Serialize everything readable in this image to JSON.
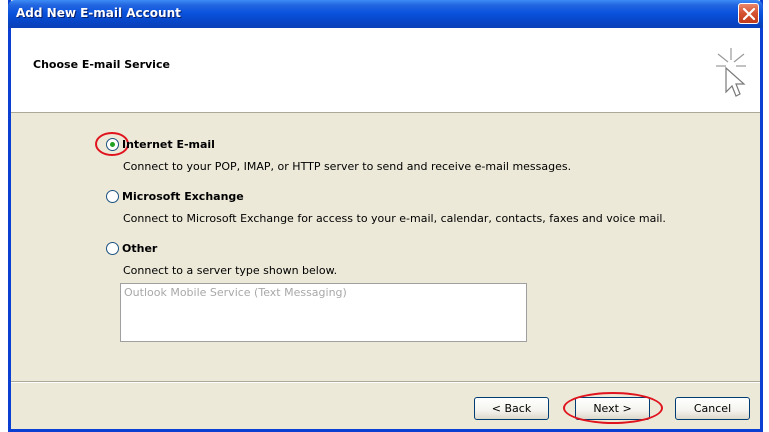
{
  "window": {
    "title": "Add New E-mail Account"
  },
  "header": {
    "title": "Choose E-mail Service"
  },
  "options": [
    {
      "label": "Internet E-mail",
      "description": "Connect to your POP, IMAP, or HTTP server to send and receive e-mail messages.",
      "selected": true
    },
    {
      "label": "Microsoft Exchange",
      "description": "Connect to Microsoft Exchange for access to your e-mail, calendar, contacts, faxes and voice mail.",
      "selected": false
    },
    {
      "label": "Other",
      "description": "Connect to a server type shown below.",
      "selected": false
    }
  ],
  "server_list": {
    "items": [
      "Outlook Mobile Service (Text Messaging)"
    ]
  },
  "buttons": {
    "back": "< Back",
    "next": "Next >",
    "cancel": "Cancel"
  },
  "colors": {
    "titlebar": "#0a53de",
    "dialog_bg": "#ece9d8",
    "highlight": "#e0141e"
  }
}
